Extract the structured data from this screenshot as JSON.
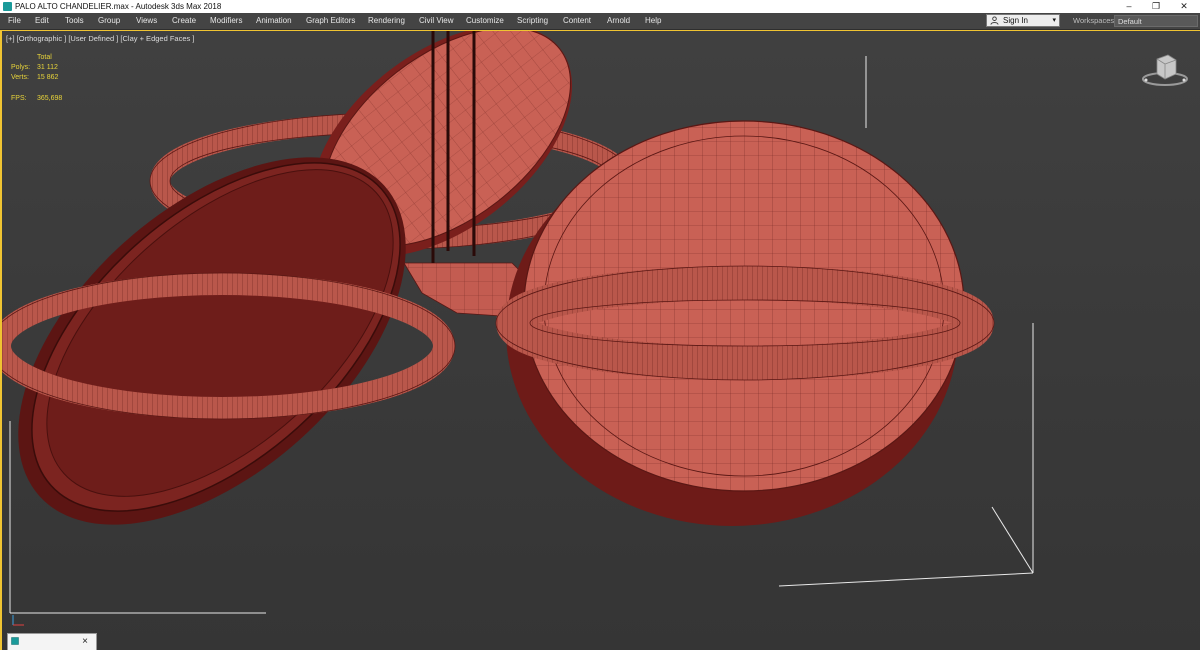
{
  "window": {
    "title": "PALO ALTO CHANDELIER.max - Autodesk 3ds Max 2018",
    "controls": {
      "minimize": "–",
      "restore": "❐",
      "close": "✕"
    }
  },
  "menu": {
    "items": [
      "File",
      "Edit",
      "Tools",
      "Group",
      "Views",
      "Create",
      "Modifiers",
      "Animation",
      "Graph Editors",
      "Rendering",
      "Civil View",
      "Customize",
      "Scripting",
      "Content",
      "Arnold",
      "Help"
    ]
  },
  "account": {
    "sign_in": "Sign In",
    "caret": "▾"
  },
  "workspaces": {
    "label": "Workspaces:",
    "value": "Default"
  },
  "viewport": {
    "label": "[+] [Orthographic ] [User Defined ] [Clay + Edged Faces ]",
    "stats": {
      "total_label": "Total",
      "polys_label": "Polys:",
      "polys_value": "31 112",
      "verts_label": "Verts:",
      "verts_value": "15 862",
      "fps_label": "FPS:",
      "fps_value": "365,698"
    }
  },
  "tray": {
    "close": "×"
  },
  "colors": {
    "clay": "#c96155",
    "clay_dark": "#7a1f1c",
    "viewport_border": "#f0c432",
    "stats_text": "#e8d43a"
  }
}
